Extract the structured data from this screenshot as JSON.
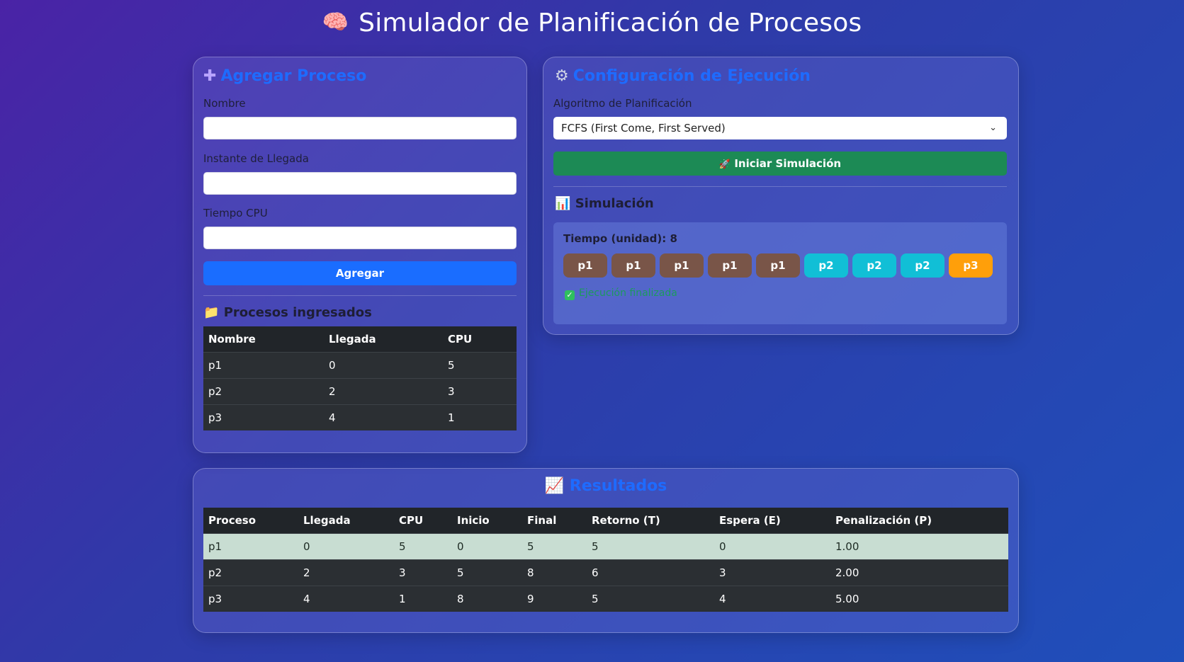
{
  "header": {
    "icon": "brain-icon",
    "title": "Simulador de Planificación de Procesos"
  },
  "add_process": {
    "title": "Agregar Proceso",
    "icon": "plus-icon",
    "fields": [
      {
        "label": "Nombre",
        "value": ""
      },
      {
        "label": "Instante de Llegada",
        "value": ""
      },
      {
        "label": "Tiempo CPU",
        "value": ""
      }
    ],
    "submit_label": "Agregar",
    "list_title": "Procesos ingresados",
    "list_icon": "folder-icon",
    "columns": [
      "Nombre",
      "Llegada",
      "CPU"
    ],
    "rows": [
      [
        "p1",
        "0",
        "5"
      ],
      [
        "p2",
        "2",
        "3"
      ],
      [
        "p3",
        "4",
        "1"
      ]
    ]
  },
  "config": {
    "title": "Configuración de Ejecución",
    "icon": "gear-icon",
    "algorithm_label": "Algoritmo de Planificación",
    "algorithm_value": "FCFS (First Come, First Served)",
    "start_label": "Iniciar Simulación",
    "start_icon": "rocket-icon",
    "sim_title": "Simulación",
    "sim_icon": "bar-chart-icon",
    "time_label": "Tiempo (unidad): 8",
    "blocks": [
      {
        "label": "p1",
        "color": "#795548"
      },
      {
        "label": "p1",
        "color": "#795548"
      },
      {
        "label": "p1",
        "color": "#795548"
      },
      {
        "label": "p1",
        "color": "#795548"
      },
      {
        "label": "p1",
        "color": "#795548"
      },
      {
        "label": "p2",
        "color": "#11bfd6"
      },
      {
        "label": "p2",
        "color": "#11bfd6"
      },
      {
        "label": "p2",
        "color": "#11bfd6"
      },
      {
        "label": "p3",
        "color": "#ff9f0a"
      }
    ],
    "status_text": "Ejecución finalizada"
  },
  "results": {
    "title": "Resultados",
    "icon": "trend-chart-icon",
    "columns": [
      "Proceso",
      "Llegada",
      "CPU",
      "Inicio",
      "Final",
      "Retorno (T)",
      "Espera (E)",
      "Penalización (P)"
    ],
    "rows": [
      [
        "p1",
        "0",
        "5",
        "0",
        "5",
        "5",
        "0",
        "1.00"
      ],
      [
        "p2",
        "2",
        "3",
        "5",
        "8",
        "6",
        "3",
        "2.00"
      ],
      [
        "p3",
        "4",
        "1",
        "8",
        "9",
        "5",
        "4",
        "5.00"
      ]
    ]
  }
}
